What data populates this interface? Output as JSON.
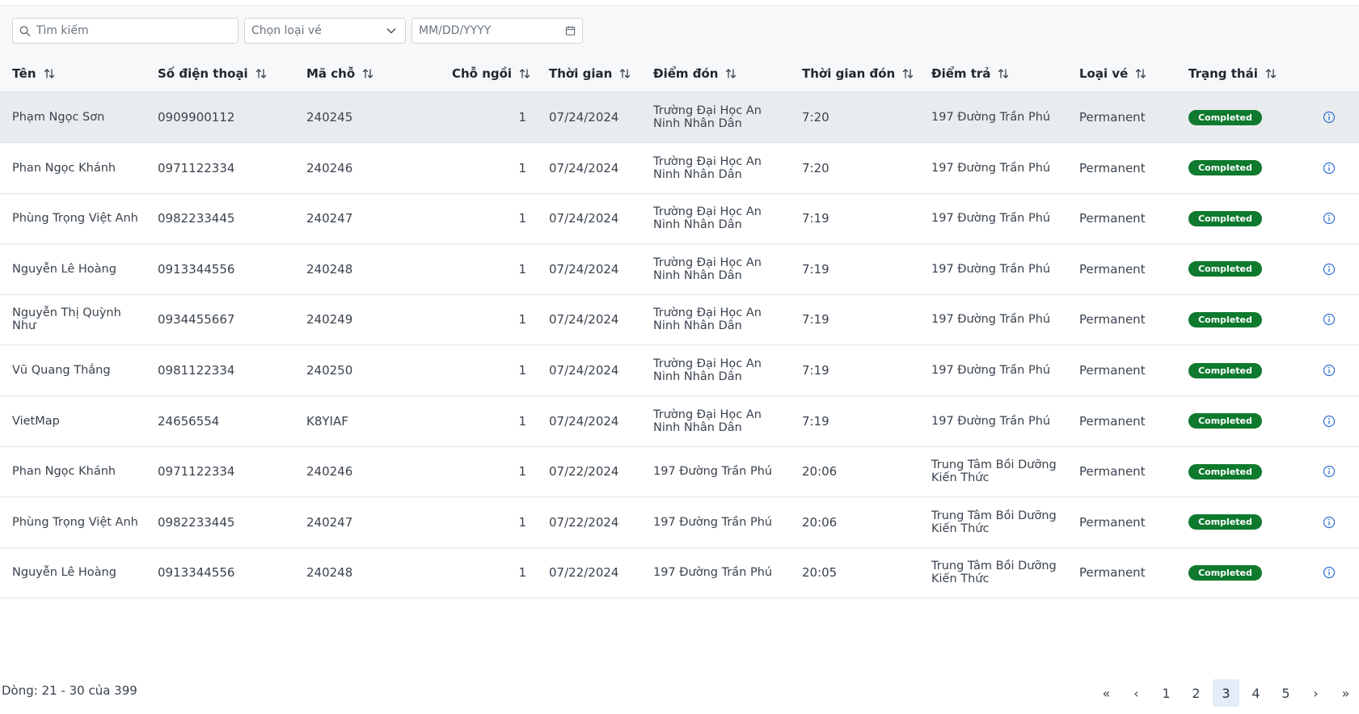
{
  "filters": {
    "search_placeholder": "Tìm kiếm",
    "ticket_type_placeholder": "Chọn loại vé",
    "date_placeholder": "MM/DD/YYYY"
  },
  "columns": {
    "name": "Tên",
    "phone": "Số điện thoại",
    "seat_code": "Mã chỗ",
    "seats": "Chỗ ngồi",
    "time": "Thời gian",
    "pickup": "Điểm đón",
    "pickup_time": "Thời gian đón",
    "dropoff": "Điểm trả",
    "ticket_type": "Loại vé",
    "status": "Trạng thái"
  },
  "rows": [
    {
      "name": "Phạm Ngọc Sơn",
      "phone": "0909900112",
      "code": "240245",
      "seats": "1",
      "date": "07/24/2024",
      "pickup": [
        "Trường Đại Học An",
        "Ninh Nhân Dân"
      ],
      "pickup_time": "7:20",
      "dropoff": [
        "197 Đường Trần Phú"
      ],
      "type": "Permanent",
      "status": "Completed"
    },
    {
      "name": "Phan Ngọc Khánh",
      "phone": "0971122334",
      "code": "240246",
      "seats": "1",
      "date": "07/24/2024",
      "pickup": [
        "Trường Đại Học An",
        "Ninh Nhân Dân"
      ],
      "pickup_time": "7:20",
      "dropoff": [
        "197 Đường Trần Phú"
      ],
      "type": "Permanent",
      "status": "Completed"
    },
    {
      "name": "Phùng Trọng Việt Anh",
      "phone": "0982233445",
      "code": "240247",
      "seats": "1",
      "date": "07/24/2024",
      "pickup": [
        "Trường Đại Học An",
        "Ninh Nhân Dân"
      ],
      "pickup_time": "7:19",
      "dropoff": [
        "197 Đường Trần Phú"
      ],
      "type": "Permanent",
      "status": "Completed"
    },
    {
      "name": "Nguyễn Lê Hoàng",
      "phone": "0913344556",
      "code": "240248",
      "seats": "1",
      "date": "07/24/2024",
      "pickup": [
        "Trường Đại Học An",
        "Ninh Nhân Dân"
      ],
      "pickup_time": "7:19",
      "dropoff": [
        "197 Đường Trần Phú"
      ],
      "type": "Permanent",
      "status": "Completed"
    },
    {
      "name": "Nguyễn Thị Quỳnh Như",
      "phone": "0934455667",
      "code": "240249",
      "seats": "1",
      "date": "07/24/2024",
      "pickup": [
        "Trường Đại Học An",
        "Ninh Nhân Dân"
      ],
      "pickup_time": "7:19",
      "dropoff": [
        "197 Đường Trần Phú"
      ],
      "type": "Permanent",
      "status": "Completed"
    },
    {
      "name": "Vũ Quang Thắng",
      "phone": "0981122334",
      "code": "240250",
      "seats": "1",
      "date": "07/24/2024",
      "pickup": [
        "Trường Đại Học An",
        "Ninh Nhân Dân"
      ],
      "pickup_time": "7:19",
      "dropoff": [
        "197 Đường Trần Phú"
      ],
      "type": "Permanent",
      "status": "Completed"
    },
    {
      "name": "VietMap",
      "phone": "24656554",
      "code": "K8YIAF",
      "seats": "1",
      "date": "07/24/2024",
      "pickup": [
        "Trường Đại Học An",
        "Ninh Nhân Dân"
      ],
      "pickup_time": "7:19",
      "dropoff": [
        "197 Đường Trần Phú"
      ],
      "type": "Permanent",
      "status": "Completed"
    },
    {
      "name": "Phan Ngọc Khánh",
      "phone": "0971122334",
      "code": "240246",
      "seats": "1",
      "date": "07/22/2024",
      "pickup": [
        "197 Đường Trần Phú"
      ],
      "pickup_time": "20:06",
      "dropoff": [
        "Trung Tâm Bồi Dưỡng",
        "Kiến Thức"
      ],
      "type": "Permanent",
      "status": "Completed"
    },
    {
      "name": "Phùng Trọng Việt Anh",
      "phone": "0982233445",
      "code": "240247",
      "seats": "1",
      "date": "07/22/2024",
      "pickup": [
        "197 Đường Trần Phú"
      ],
      "pickup_time": "20:06",
      "dropoff": [
        "Trung Tâm Bồi Dưỡng",
        "Kiến Thức"
      ],
      "type": "Permanent",
      "status": "Completed"
    },
    {
      "name": "Nguyễn Lê Hoàng",
      "phone": "0913344556",
      "code": "240248",
      "seats": "1",
      "date": "07/22/2024",
      "pickup": [
        "197 Đường Trần Phú"
      ],
      "pickup_time": "20:05",
      "dropoff": [
        "Trung Tâm Bồi Dưỡng",
        "Kiến Thức"
      ],
      "type": "Permanent",
      "status": "Completed"
    }
  ],
  "selected_row": 0,
  "footer": {
    "row_info": "Dòng: 21 - 30 của 399"
  },
  "pagination": {
    "first": "«",
    "prev": "‹",
    "pages": [
      "1",
      "2",
      "3",
      "4",
      "5"
    ],
    "active_page": "3",
    "next": "›",
    "last": "»"
  },
  "colors": {
    "status_completed": "#0f7a2e",
    "selected_row": "#e9ecef",
    "active_page": "#e3ecf7",
    "info_icon": "#2f6fd6"
  },
  "icons": {
    "search": "search-icon",
    "dropdown": "chevron-down-icon",
    "date": "calendar-icon",
    "sort": "sort-icon",
    "row_action": "info-icon"
  }
}
